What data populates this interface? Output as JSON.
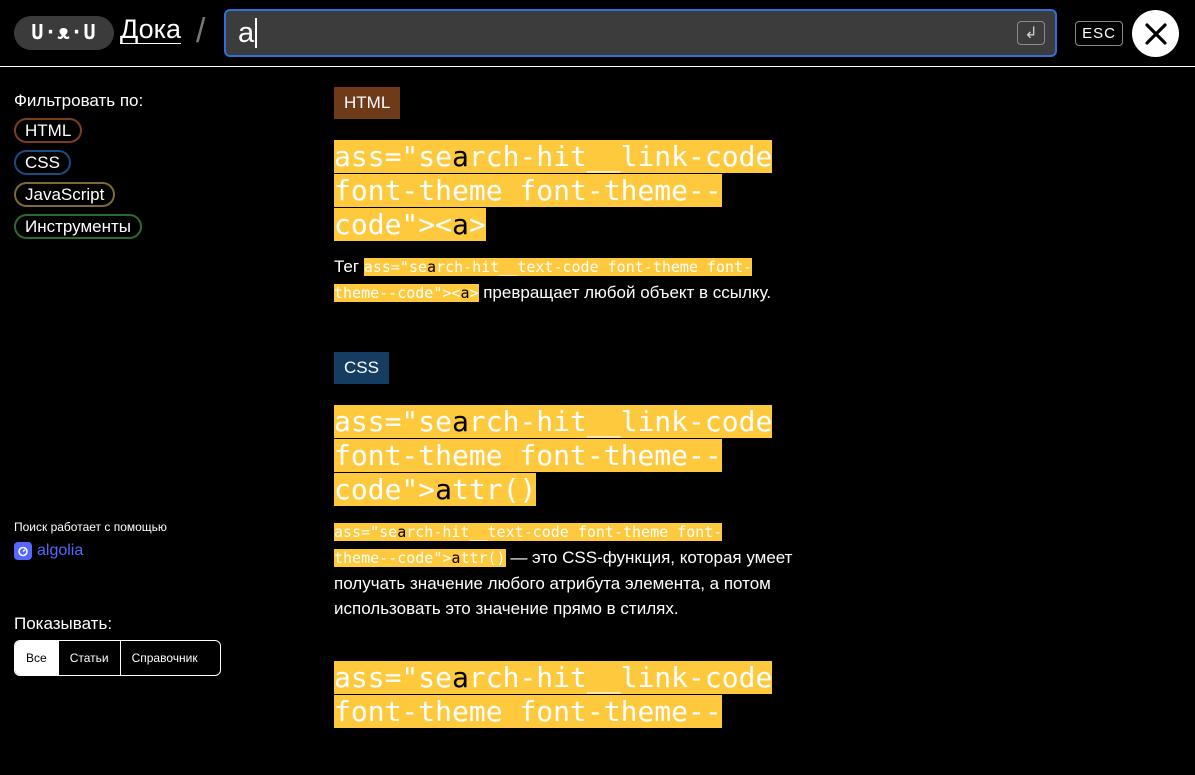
{
  "header": {
    "logo": "U·ᴥ·U",
    "site_name": "Дока",
    "separator": "/",
    "search_value": "a",
    "enter_key": "↲",
    "esc_label": "ESC"
  },
  "sidebar": {
    "filter_title": "Фильтровать по:",
    "filters": [
      {
        "label": "HTML",
        "color": "#7a3f1e"
      },
      {
        "label": "CSS",
        "color": "#1f4a80"
      },
      {
        "label": "JavaScript",
        "color": "#7f6a33"
      },
      {
        "label": "Инструменты",
        "color": "#2c6b2c"
      }
    ],
    "algolia_note": "Поиск работает с помощью",
    "algolia_label": "algolia",
    "show_title": "Показывать:",
    "show_options": [
      "Все",
      "Статьи",
      "Справочник"
    ],
    "show_selected": "Все"
  },
  "results": [
    {
      "category": "HTML",
      "category_color": "#7a3f1e",
      "title_lines": [
        [
          "ass=\"se",
          "a",
          "rch-hit__link-code"
        ],
        [
          "font-theme font-theme--"
        ],
        [
          "code\"><",
          "a",
          ">"
        ]
      ],
      "desc_code_1": [
        "ass=\"se",
        "a",
        "rch-hit__text-code font-theme font-"
      ],
      "desc_code_2": [
        "theme--code\"><",
        "a",
        ">"
      ],
      "desc_prefix": "Тег ",
      "desc_suffix": " превращает любой объект в ссылку."
    },
    {
      "category": "CSS",
      "category_color": "#153d62",
      "title_lines": [
        [
          "ass=\"se",
          "a",
          "rch-hit__link-code"
        ],
        [
          "font-theme font-theme--"
        ],
        [
          "code\">",
          "a",
          "ttr()"
        ]
      ],
      "desc_code_1": [
        "ass=\"se",
        "a",
        "rch-hit__text-code font-theme font-"
      ],
      "desc_code_2": [
        "theme--code\">",
        "a",
        "ttr()"
      ],
      "desc_suffix_1": " — это CSS-функция, которая умеет",
      "desc_line_2": "получать значение любого атрибута элемента, а потом",
      "desc_line_3": "использовать это значение прямо в стилях."
    },
    {
      "title_lines": [
        [
          "ass=\"se",
          "a",
          "rch-hit__link-code"
        ],
        [
          "font-theme font-theme--"
        ]
      ]
    }
  ]
}
